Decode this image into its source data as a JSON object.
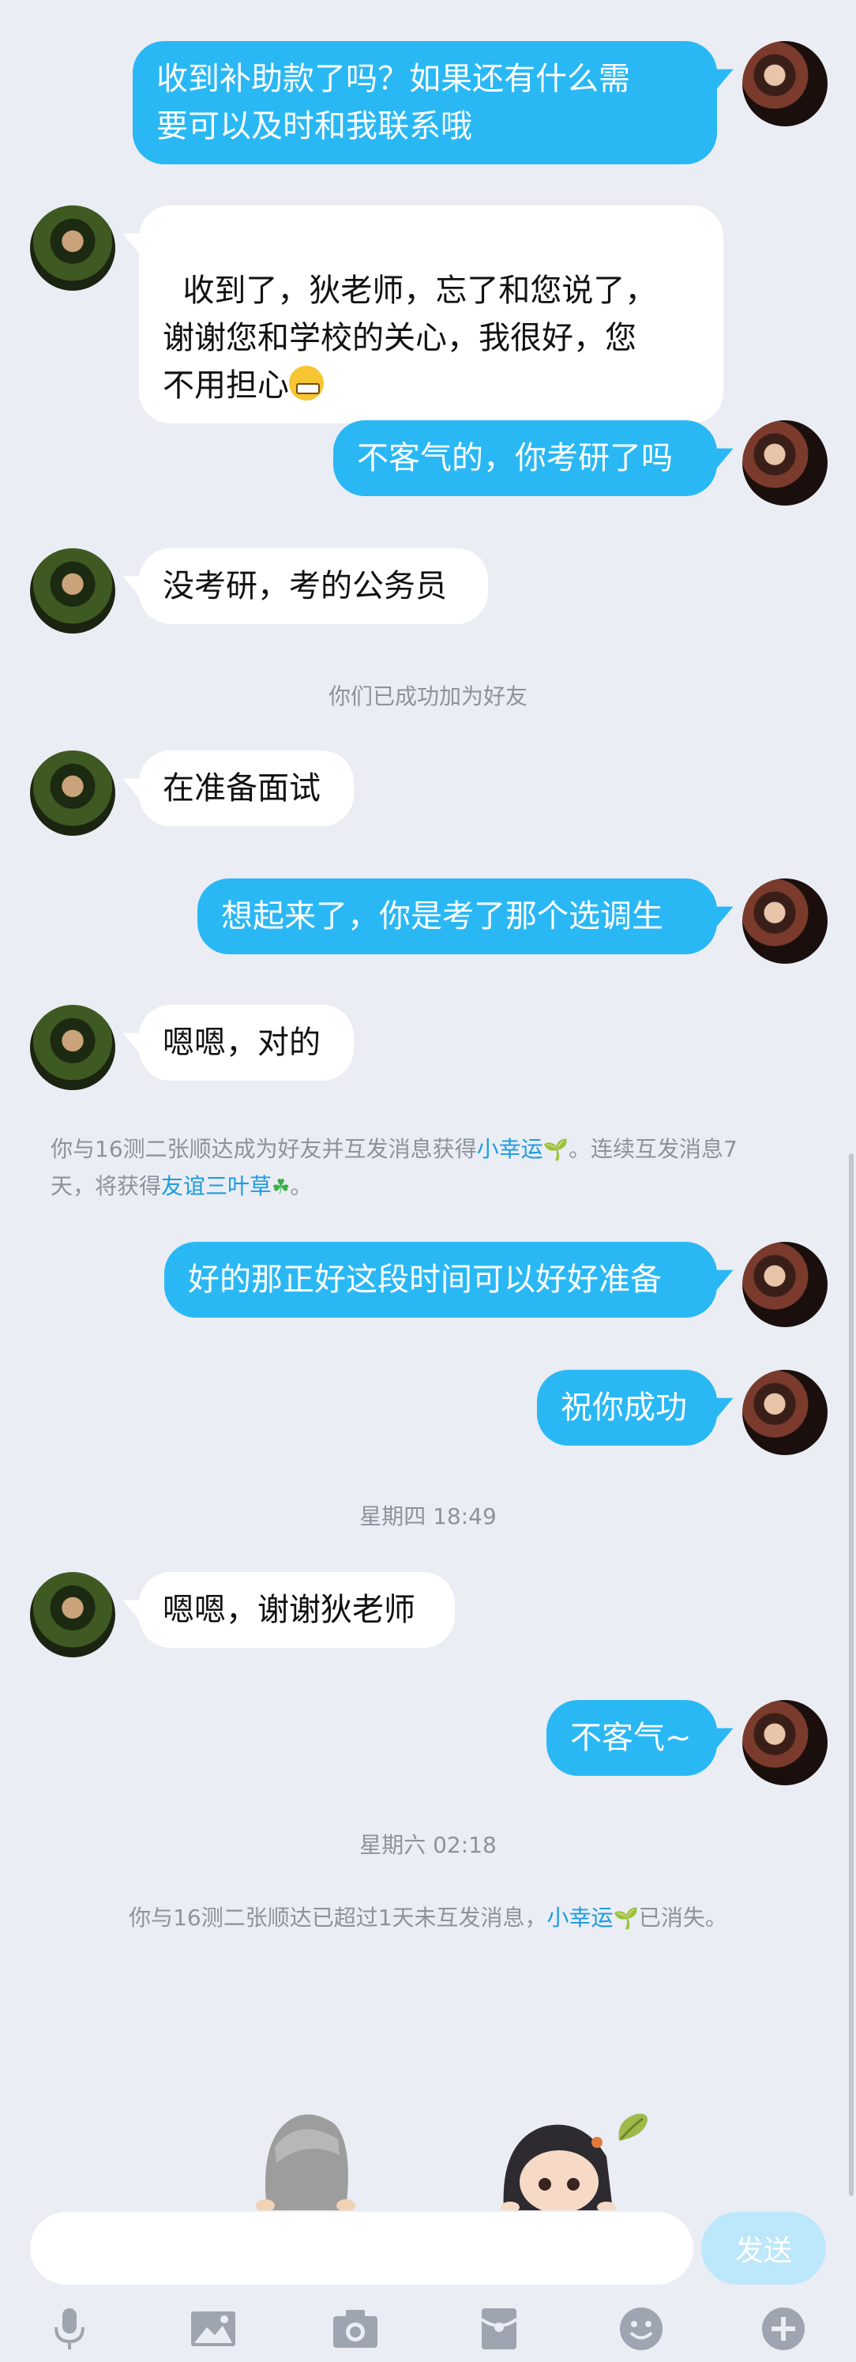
{
  "messages": [
    {
      "from": "me",
      "text": "收到补助款了吗？如果还有什么需\n要可以及时和我联系哦"
    },
    {
      "from": "them",
      "text": "收到了，狄老师，忘了和您说了，\n谢谢您和学校的关心，我很好，您\n不用担心"
    },
    {
      "from": "me",
      "text": "不客气的，你考研了吗"
    },
    {
      "from": "them",
      "text": "没考研，考的公务员"
    },
    {
      "from": "them",
      "text": "在准备面试"
    },
    {
      "from": "me",
      "text": "想起来了，你是考了那个选调生"
    },
    {
      "from": "them",
      "text": "嗯嗯，对的"
    },
    {
      "from": "me",
      "text": "好的那正好这段时间可以好好准备"
    },
    {
      "from": "me",
      "text": "祝你成功"
    },
    {
      "from": "them",
      "text": "嗯嗯，谢谢狄老师"
    },
    {
      "from": "me",
      "text": "不客气~"
    }
  ],
  "system": {
    "friends_added": "你们已成功加为好友",
    "lucky_part1": "你与16测二张顺达成为好友并互发消息获得",
    "lucky_link": "小幸运",
    "lucky_part2": "。连续互发消息7",
    "lucky_part3": "天，将获得",
    "clover_link": "友谊三叶草",
    "lucky_part4": "。",
    "time1": "星期四 18:49",
    "time2": "星期六 02:18",
    "lost_part1": "你与16测二张顺达已超过1天未互发消息，",
    "lost_link": "小幸运",
    "lost_part2": "已消失。"
  },
  "input": {
    "placeholder": "",
    "send_label": "发送"
  },
  "toolbar_icons": [
    "microphone-icon",
    "image-icon",
    "camera-icon",
    "red-packet-icon",
    "emoji-icon",
    "plus-icon"
  ],
  "colors": {
    "my_bubble": "#2ab8f5",
    "their_bubble": "#ffffff",
    "background": "#eaedf4",
    "link": "#1e9be0",
    "send_disabled": "#bde7fb"
  }
}
